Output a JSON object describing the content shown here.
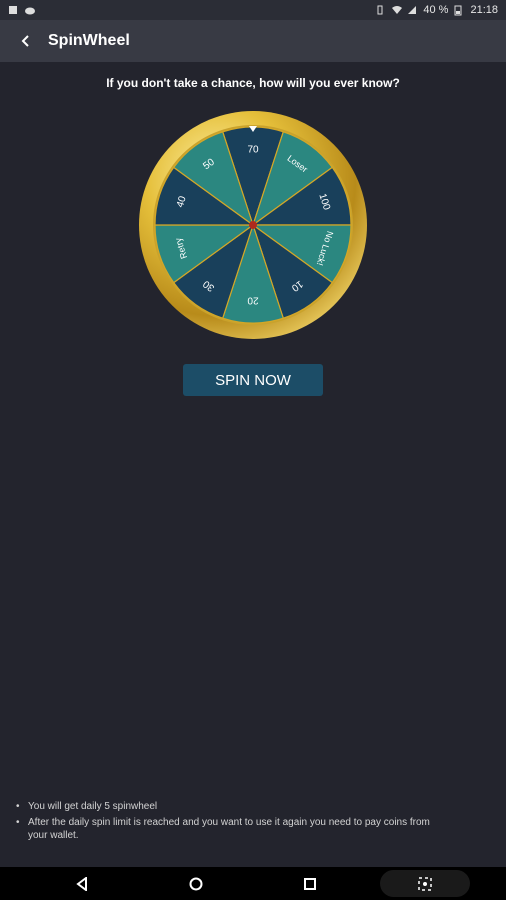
{
  "status_bar": {
    "battery": "40 %",
    "time": "21:18"
  },
  "app_bar": {
    "title": "SpinWheel",
    "back_icon": "back-arrow-icon"
  },
  "tagline": "If you don't take a chance, how will you ever know?",
  "wheel": {
    "segments": [
      "70",
      "Loser",
      "100",
      "No Luck!",
      "10",
      "20",
      "30",
      "Retry",
      "40",
      "50"
    ],
    "colors": {
      "dark": "#19405b",
      "teal": "#2b8780",
      "rim": "#d4a727",
      "center": "#b02a1d"
    }
  },
  "spin_button": {
    "label": "SPIN NOW"
  },
  "notes": [
    "You will get daily 5 spinwheel",
    "After the daily spin limit is reached and you want to use it again you need to pay coins from your wallet."
  ]
}
